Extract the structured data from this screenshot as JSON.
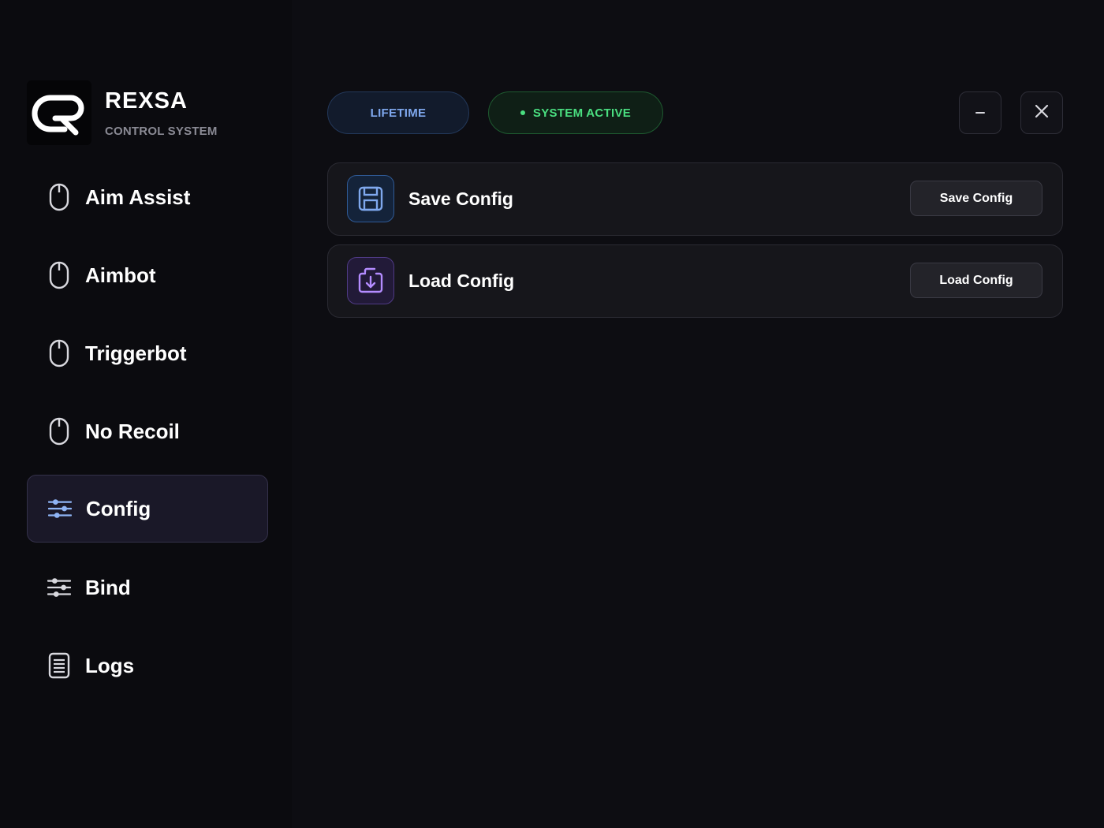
{
  "brand": {
    "name": "REXSA",
    "subtitle": "CONTROL SYSTEM",
    "logo_icon": "rexsa-logo"
  },
  "sidebar": {
    "items": [
      {
        "label": "Aim Assist",
        "icon": "mouse-icon",
        "active": false
      },
      {
        "label": "Aimbot",
        "icon": "mouse-icon",
        "active": false
      },
      {
        "label": "Triggerbot",
        "icon": "mouse-icon",
        "active": false
      },
      {
        "label": "No Recoil",
        "icon": "mouse-icon",
        "active": false
      },
      {
        "label": "Config",
        "icon": "sliders-icon",
        "active": true
      },
      {
        "label": "Bind",
        "icon": "sliders-icon",
        "active": false
      },
      {
        "label": "Logs",
        "icon": "document-icon",
        "active": false
      }
    ]
  },
  "header": {
    "license_badge": "LIFETIME",
    "status_badge": "SYSTEM ACTIVE",
    "minimize_icon": "minus-icon",
    "close_icon": "close-icon"
  },
  "cards": [
    {
      "title": "Save Config",
      "button": "Save Config",
      "icon": "floppy-disk-icon"
    },
    {
      "title": "Load Config",
      "button": "Load Config",
      "icon": "import-icon"
    }
  ],
  "colors": {
    "background": "#0d0d12",
    "sidebar": "#0b0b0f",
    "active_nav": "#1a1828",
    "accent_blue": "#7fa8ee",
    "accent_green": "#4ade80",
    "accent_purple": "#b48cff"
  }
}
